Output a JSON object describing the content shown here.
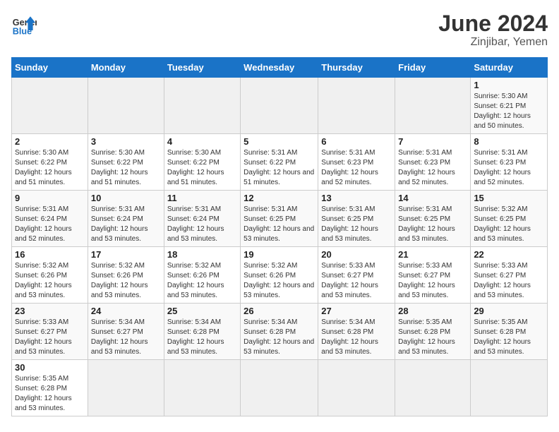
{
  "logo": {
    "text_general": "General",
    "text_blue": "Blue"
  },
  "title": "June 2024",
  "subtitle": "Zinjibar, Yemen",
  "days_of_week": [
    "Sunday",
    "Monday",
    "Tuesday",
    "Wednesday",
    "Thursday",
    "Friday",
    "Saturday"
  ],
  "weeks": [
    [
      {
        "day": "",
        "info": ""
      },
      {
        "day": "",
        "info": ""
      },
      {
        "day": "",
        "info": ""
      },
      {
        "day": "",
        "info": ""
      },
      {
        "day": "",
        "info": ""
      },
      {
        "day": "",
        "info": ""
      },
      {
        "day": "1",
        "info": "Sunrise: 5:30 AM\nSunset: 6:21 PM\nDaylight: 12 hours and 50 minutes."
      }
    ],
    [
      {
        "day": "2",
        "info": "Sunrise: 5:30 AM\nSunset: 6:22 PM\nDaylight: 12 hours and 51 minutes."
      },
      {
        "day": "3",
        "info": "Sunrise: 5:30 AM\nSunset: 6:22 PM\nDaylight: 12 hours and 51 minutes."
      },
      {
        "day": "4",
        "info": "Sunrise: 5:30 AM\nSunset: 6:22 PM\nDaylight: 12 hours and 51 minutes."
      },
      {
        "day": "5",
        "info": "Sunrise: 5:31 AM\nSunset: 6:22 PM\nDaylight: 12 hours and 51 minutes."
      },
      {
        "day": "6",
        "info": "Sunrise: 5:31 AM\nSunset: 6:23 PM\nDaylight: 12 hours and 52 minutes."
      },
      {
        "day": "7",
        "info": "Sunrise: 5:31 AM\nSunset: 6:23 PM\nDaylight: 12 hours and 52 minutes."
      },
      {
        "day": "8",
        "info": "Sunrise: 5:31 AM\nSunset: 6:23 PM\nDaylight: 12 hours and 52 minutes."
      }
    ],
    [
      {
        "day": "9",
        "info": "Sunrise: 5:31 AM\nSunset: 6:24 PM\nDaylight: 12 hours and 52 minutes."
      },
      {
        "day": "10",
        "info": "Sunrise: 5:31 AM\nSunset: 6:24 PM\nDaylight: 12 hours and 53 minutes."
      },
      {
        "day": "11",
        "info": "Sunrise: 5:31 AM\nSunset: 6:24 PM\nDaylight: 12 hours and 53 minutes."
      },
      {
        "day": "12",
        "info": "Sunrise: 5:31 AM\nSunset: 6:25 PM\nDaylight: 12 hours and 53 minutes."
      },
      {
        "day": "13",
        "info": "Sunrise: 5:31 AM\nSunset: 6:25 PM\nDaylight: 12 hours and 53 minutes."
      },
      {
        "day": "14",
        "info": "Sunrise: 5:31 AM\nSunset: 6:25 PM\nDaylight: 12 hours and 53 minutes."
      },
      {
        "day": "15",
        "info": "Sunrise: 5:32 AM\nSunset: 6:25 PM\nDaylight: 12 hours and 53 minutes."
      }
    ],
    [
      {
        "day": "16",
        "info": "Sunrise: 5:32 AM\nSunset: 6:26 PM\nDaylight: 12 hours and 53 minutes."
      },
      {
        "day": "17",
        "info": "Sunrise: 5:32 AM\nSunset: 6:26 PM\nDaylight: 12 hours and 53 minutes."
      },
      {
        "day": "18",
        "info": "Sunrise: 5:32 AM\nSunset: 6:26 PM\nDaylight: 12 hours and 53 minutes."
      },
      {
        "day": "19",
        "info": "Sunrise: 5:32 AM\nSunset: 6:26 PM\nDaylight: 12 hours and 53 minutes."
      },
      {
        "day": "20",
        "info": "Sunrise: 5:33 AM\nSunset: 6:27 PM\nDaylight: 12 hours and 53 minutes."
      },
      {
        "day": "21",
        "info": "Sunrise: 5:33 AM\nSunset: 6:27 PM\nDaylight: 12 hours and 53 minutes."
      },
      {
        "day": "22",
        "info": "Sunrise: 5:33 AM\nSunset: 6:27 PM\nDaylight: 12 hours and 53 minutes."
      }
    ],
    [
      {
        "day": "23",
        "info": "Sunrise: 5:33 AM\nSunset: 6:27 PM\nDaylight: 12 hours and 53 minutes."
      },
      {
        "day": "24",
        "info": "Sunrise: 5:34 AM\nSunset: 6:27 PM\nDaylight: 12 hours and 53 minutes."
      },
      {
        "day": "25",
        "info": "Sunrise: 5:34 AM\nSunset: 6:28 PM\nDaylight: 12 hours and 53 minutes."
      },
      {
        "day": "26",
        "info": "Sunrise: 5:34 AM\nSunset: 6:28 PM\nDaylight: 12 hours and 53 minutes."
      },
      {
        "day": "27",
        "info": "Sunrise: 5:34 AM\nSunset: 6:28 PM\nDaylight: 12 hours and 53 minutes."
      },
      {
        "day": "28",
        "info": "Sunrise: 5:35 AM\nSunset: 6:28 PM\nDaylight: 12 hours and 53 minutes."
      },
      {
        "day": "29",
        "info": "Sunrise: 5:35 AM\nSunset: 6:28 PM\nDaylight: 12 hours and 53 minutes."
      }
    ],
    [
      {
        "day": "30",
        "info": "Sunrise: 5:35 AM\nSunset: 6:28 PM\nDaylight: 12 hours and 53 minutes."
      },
      {
        "day": "",
        "info": ""
      },
      {
        "day": "",
        "info": ""
      },
      {
        "day": "",
        "info": ""
      },
      {
        "day": "",
        "info": ""
      },
      {
        "day": "",
        "info": ""
      },
      {
        "day": "",
        "info": ""
      }
    ]
  ]
}
